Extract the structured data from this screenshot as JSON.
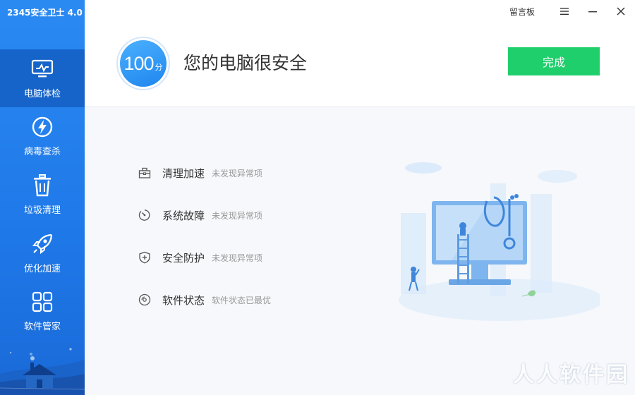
{
  "app": {
    "title": "2345安全卫士 4.0"
  },
  "window_controls": {
    "guestbook": "留言板"
  },
  "sidebar": {
    "items": [
      {
        "label": "电脑体检",
        "icon": "monitor-check-icon",
        "active": true
      },
      {
        "label": "病毒查杀",
        "icon": "lightning-shield-icon",
        "active": false
      },
      {
        "label": "垃圾清理",
        "icon": "trash-icon",
        "active": false
      },
      {
        "label": "优化加速",
        "icon": "rocket-icon",
        "active": false
      },
      {
        "label": "软件管家",
        "icon": "apps-grid-icon",
        "active": false
      }
    ]
  },
  "header": {
    "score": "100",
    "score_unit": "分",
    "status": "您的电脑很安全",
    "done_label": "完成"
  },
  "checks": [
    {
      "title": "清理加速",
      "status": "未发现异常项",
      "icon": "toolbox-icon"
    },
    {
      "title": "系统故障",
      "status": "未发现异常项",
      "icon": "gauge-icon"
    },
    {
      "title": "安全防护",
      "status": "未发现异常项",
      "icon": "shield-plus-icon"
    },
    {
      "title": "软件状态",
      "status": "软件状态已最优",
      "icon": "disc-icon"
    }
  ],
  "colors": {
    "sidebar": "#2a8af2",
    "active": "#1664c9",
    "done_button": "#1fcf6b",
    "score": "#1e86ee"
  },
  "watermark": "人人软件园"
}
